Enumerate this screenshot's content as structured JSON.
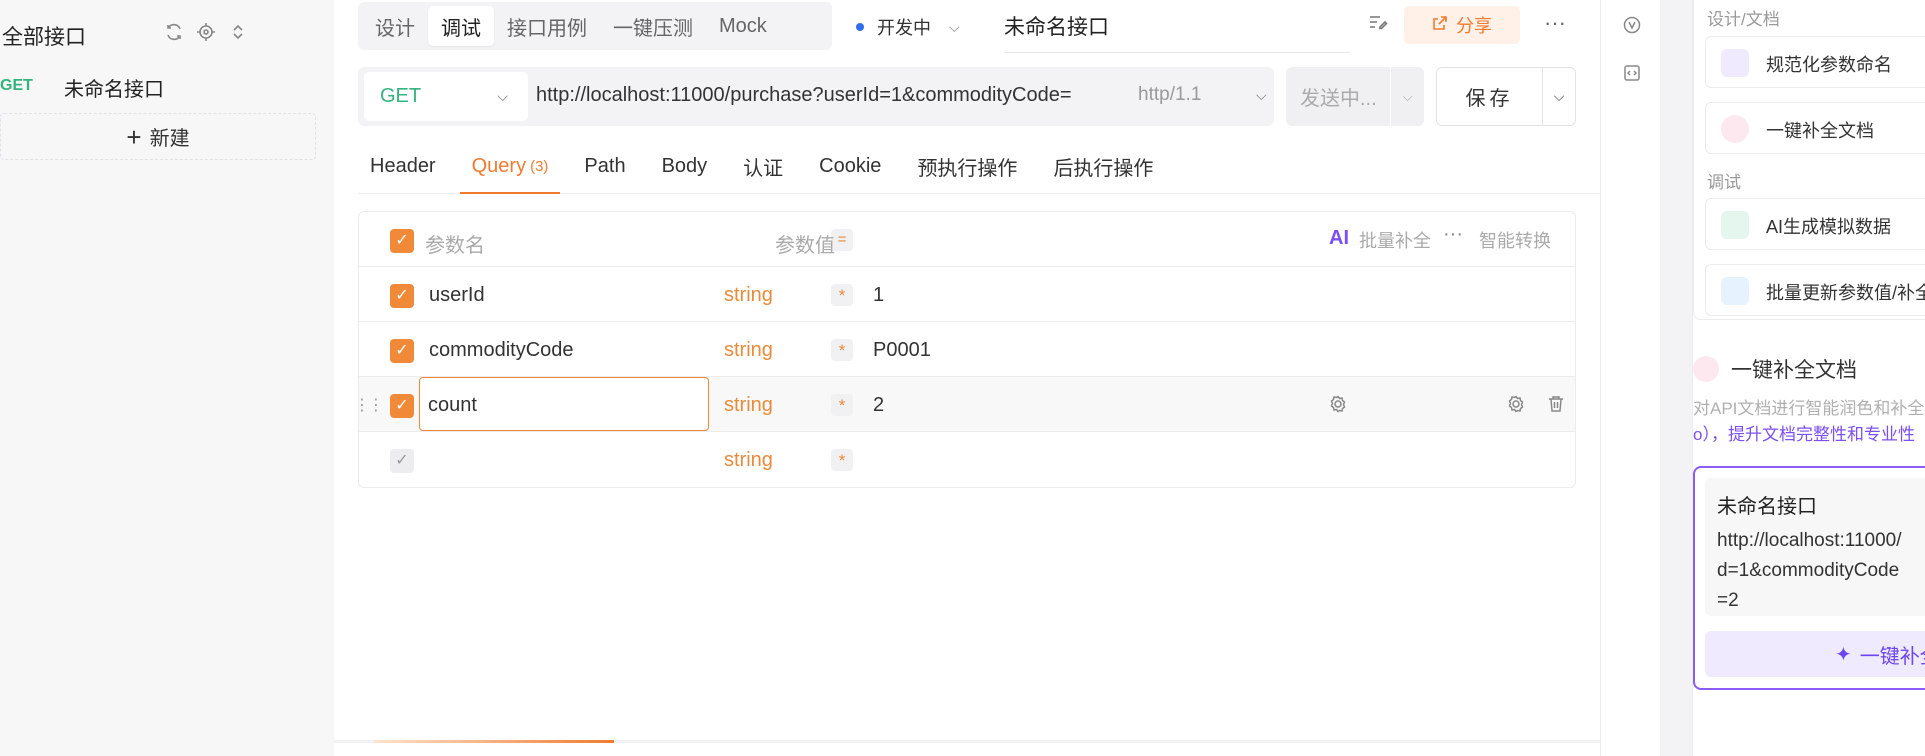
{
  "sidebar": {
    "title": "全部接口",
    "item": {
      "method": "GET",
      "name": "未命名接口"
    },
    "new_label": "新建"
  },
  "topbar": {
    "tabs": [
      {
        "label": "设计",
        "active": false
      },
      {
        "label": "调试",
        "active": true
      },
      {
        "label": "接口用例",
        "active": false
      },
      {
        "label": "一键压测",
        "active": false
      },
      {
        "label": "Mock",
        "active": false
      }
    ],
    "status": "开发中",
    "api_name": "未命名接口",
    "share_label": "分享"
  },
  "request": {
    "method": "GET",
    "url": "http://localhost:11000/purchase?userId=1&commodityCode=",
    "protocol": "http/1.1",
    "send_label": "发送中...",
    "save_label": "保存"
  },
  "subtabs": [
    {
      "label": "Header",
      "active": false
    },
    {
      "label": "Query",
      "count": "(3)",
      "active": true
    },
    {
      "label": "Path",
      "active": false
    },
    {
      "label": "Body",
      "active": false
    },
    {
      "label": "认证",
      "active": false
    },
    {
      "label": "Cookie",
      "active": false
    },
    {
      "label": "预执行操作",
      "active": false
    },
    {
      "label": "后执行操作",
      "active": false
    }
  ],
  "params": {
    "header": {
      "name_placeholder": "参数名",
      "eq": "=",
      "value_placeholder": "参数值",
      "ai_logo": "AI",
      "bulk_fill": "批量补全",
      "smart_convert": "智能转换"
    },
    "rows": [
      {
        "name": "userId",
        "type": "string",
        "required": "*",
        "value": "1"
      },
      {
        "name": "commodityCode",
        "type": "string",
        "required": "*",
        "value": "P0001"
      },
      {
        "name": "count",
        "type": "string",
        "required": "*",
        "value": "2"
      },
      {
        "name": "",
        "type": "string",
        "required": "*",
        "value": ""
      }
    ]
  },
  "right_panel": {
    "section_design": "设计/文档",
    "cards_design": [
      "规范化参数命名",
      "一键补全文档"
    ],
    "section_debug": "调试",
    "cards_debug": [
      "AI生成模拟数据",
      "批量更新参数值/补全"
    ],
    "doc_title": "一键补全文档",
    "doc_desc_line1": "对API文档进行智能润色和补全",
    "doc_desc_line2": "o），提升文档完整性和专业性",
    "preview_title": "未命名接口",
    "preview_url": "http://localhost:11000/\nd=1&commodityCode\n=2",
    "preview_button": "一键补全"
  },
  "colors": {
    "accent": "#f07b2f",
    "method_get": "#35b37e",
    "ai_purple": "#7b4ff0"
  }
}
